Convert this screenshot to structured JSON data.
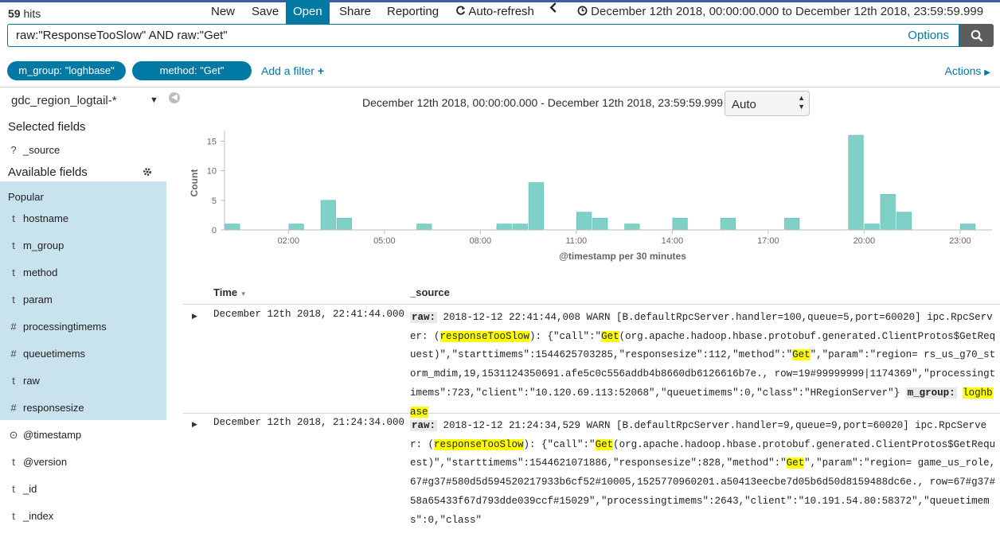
{
  "topbar": {
    "hits_count": "59",
    "hits_label": " hits",
    "menu": [
      "New",
      "Save",
      "Open",
      "Share",
      "Reporting",
      "Auto-refresh"
    ],
    "time_range": "December 12th 2018, 00:00:00.000 to December 12th 2018, 23:59:59.999"
  },
  "query": {
    "value": "raw:\"ResponseTooSlow\" AND raw:\"Get\"",
    "options_label": "Options"
  },
  "filters": {
    "items": [
      "m_group: \"loghbase\"",
      "method: \"Get\""
    ],
    "add_label": "Add a filter",
    "actions_label": "Actions"
  },
  "sidebar": {
    "index_pattern": "gdc_region_logtail-*",
    "selected_heading": "Selected fields",
    "selected_fields": [
      {
        "type": "?",
        "name": "_source"
      }
    ],
    "available_heading": "Available fields",
    "popular_heading": "Popular",
    "popular_fields": [
      {
        "type": "t",
        "name": "hostname"
      },
      {
        "type": "t",
        "name": "m_group"
      },
      {
        "type": "t",
        "name": "method"
      },
      {
        "type": "t",
        "name": "param"
      },
      {
        "type": "#",
        "name": "processingtimems"
      },
      {
        "type": "#",
        "name": "queuetimems"
      },
      {
        "type": "t",
        "name": "raw"
      },
      {
        "type": "#",
        "name": "responsesize"
      }
    ],
    "other_fields": [
      {
        "type": "⊙",
        "name": "@timestamp"
      },
      {
        "type": "t",
        "name": "@version"
      },
      {
        "type": "t",
        "name": "_id"
      },
      {
        "type": "t",
        "name": "_index"
      }
    ]
  },
  "histogram": {
    "range_text": "December 12th 2018, 00:00:00.000 - December 12th 2018, 23:59:59.999 —",
    "interval": "Auto"
  },
  "chart_data": {
    "type": "bar",
    "xlabel": "@timestamp per 30 minutes",
    "ylabel": "Count",
    "ylim": [
      0,
      16
    ],
    "yticks": [
      0,
      5,
      10,
      15
    ],
    "xticks": [
      "02:00",
      "05:00",
      "08:00",
      "11:00",
      "14:00",
      "17:00",
      "20:00",
      "23:00"
    ],
    "bars": [
      {
        "time": "00:00",
        "count": 1
      },
      {
        "time": "02:00",
        "count": 1
      },
      {
        "time": "03:00",
        "count": 5
      },
      {
        "time": "03:30",
        "count": 2
      },
      {
        "time": "06:00",
        "count": 1
      },
      {
        "time": "08:30",
        "count": 1
      },
      {
        "time": "09:00",
        "count": 1
      },
      {
        "time": "09:30",
        "count": 8
      },
      {
        "time": "11:00",
        "count": 3
      },
      {
        "time": "11:30",
        "count": 2
      },
      {
        "time": "12:30",
        "count": 1
      },
      {
        "time": "14:00",
        "count": 2
      },
      {
        "time": "15:30",
        "count": 2
      },
      {
        "time": "17:30",
        "count": 2
      },
      {
        "time": "19:30",
        "count": 16
      },
      {
        "time": "20:00",
        "count": 1
      },
      {
        "time": "20:30",
        "count": 6
      },
      {
        "time": "21:00",
        "count": 3
      },
      {
        "time": "23:00",
        "count": 1
      }
    ],
    "color": "#7fd0c6"
  },
  "table": {
    "col_time": "Time",
    "col_source": "_source",
    "rows": [
      {
        "time": "December 12th 2018, 22:41:44.000",
        "raw_tag": "raw:",
        "p1": " 2018-12-12 22:41:44,008 WARN [B.defaultRpcServer.handler=100,queue=5,port=60020] ipc.RpcServer: (",
        "h1": "responseTooSlow",
        "p2": "): {\"call\":\"",
        "h2": "Get",
        "p3": "(org.apache.hadoop.hbase.protobuf.generated.ClientProtos$GetRequest)\",\"starttimems\":1544625703285,\"responsesize\":112,\"method\":\"",
        "h3": "Get",
        "p4": "\",\"param\":\"region= rs_us_g70_storm_mdim,19,1531124350691.afe5c0c556addb4b8660db6126616b7e., row=19#99999999|1174369\",\"processingtimems\":723,\"client\":\"10.120.69.113:52068\",\"queuetimems\":0,\"class\":\"HRegionServer\"} ",
        "group_tag": "m_group:",
        "group_val": "loghbase"
      },
      {
        "time": "December 12th 2018, 21:24:34.000",
        "raw_tag": "raw:",
        "p1": " 2018-12-12 21:24:34,529 WARN [B.defaultRpcServer.handler=9,queue=9,port=60020] ipc.RpcServer: (",
        "h1": "responseTooSlow",
        "p2": "): {\"call\":\"",
        "h2": "Get",
        "p3": "(org.apache.hadoop.hbase.protobuf.generated.ClientProtos$GetRequest)\",\"starttimems\":1544621071886,\"responsesize\":828,\"method\":\"",
        "h3": "Get",
        "p4": "\",\"param\":\"region= game_us_role,67#g37#580d5d594520217933b6cf52#10005,1525770960201.a50413eecbe7d05b6d50d8159488dc6e., row=67#g37#58a65433f67d793dde039ccf#15029\",\"processingtimems\":2643,\"client\":\"10.191.54.80:58372\",\"queuetimems\":0,\"class\"",
        "group_tag": "",
        "group_val": ""
      }
    ]
  }
}
